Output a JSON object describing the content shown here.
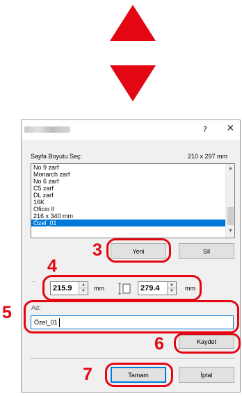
{
  "colors": {
    "callout": "#e30613",
    "selection": "#0078d7"
  },
  "arrows": {
    "up_icon": "triangle-up-icon",
    "down_icon": "triangle-down-icon"
  },
  "dialog": {
    "help_button": "?",
    "close_button": "×",
    "page_size_label": "Sayfa Boyutu Seç:",
    "page_size_value": "210 x 297 mm",
    "list_items": [
      "No 9 zarf",
      "Monarch zarf",
      "No 6 zarf",
      "C5 zarf",
      "DL zarf",
      "16K",
      "Oficio II",
      "216 x 340 mm",
      "Özel_01"
    ],
    "selected_item": "Özel_01",
    "new_button": "Yeni",
    "delete_button": "Sil",
    "width_value": "215.9",
    "width_unit": "mm",
    "height_value": "279.4",
    "height_unit": "mm",
    "name_label": "Ad:",
    "name_value": "Özel_01",
    "save_button": "Kaydet",
    "ok_button": "Tamam",
    "cancel_button": "İptal"
  },
  "callouts": {
    "c3": "3",
    "c4": "4",
    "c5": "5",
    "c6": "6",
    "c7": "7"
  }
}
